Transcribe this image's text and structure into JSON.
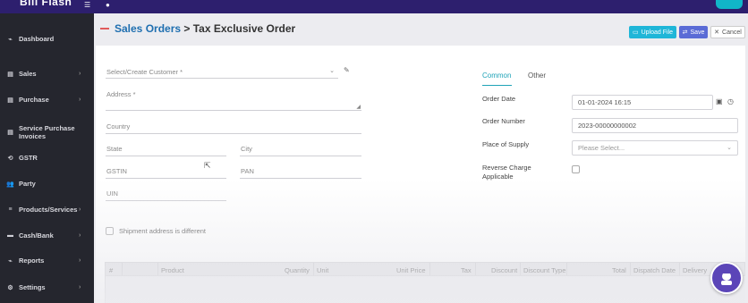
{
  "header": {
    "brand": "Bill Flash"
  },
  "sidebar": {
    "items": [
      {
        "label": "Dashboard",
        "icon": "chart-icon",
        "arrow": false
      },
      {
        "label": "Sales",
        "icon": "document-icon",
        "arrow": true
      },
      {
        "label": "Purchase",
        "icon": "document-icon",
        "arrow": true
      },
      {
        "label": "Service Purchase Invoices",
        "icon": "document-icon",
        "arrow": false
      },
      {
        "label": "GSTR",
        "icon": "refresh-icon",
        "arrow": false
      },
      {
        "label": "Party",
        "icon": "users-icon",
        "arrow": false
      },
      {
        "label": "Products/Services",
        "icon": "list-icon",
        "arrow": true
      },
      {
        "label": "Cash/Bank",
        "icon": "cash-icon",
        "arrow": true
      },
      {
        "label": "Reports",
        "icon": "chart-icon",
        "arrow": true
      },
      {
        "label": "Settings",
        "icon": "gear-icon",
        "arrow": true
      }
    ]
  },
  "page": {
    "breadcrumb_link": "Sales Orders",
    "breadcrumb_rest": " > Tax Exclusive Order"
  },
  "toolbar": {
    "upload_label": "Upload File",
    "save_label": "Save",
    "cancel_label": "Cancel"
  },
  "form": {
    "customer_placeholder": "Select/Create Customer *",
    "address_placeholder": "Address *",
    "country_placeholder": "Country",
    "state_placeholder": "State",
    "city_placeholder": "City",
    "gstin_placeholder": "GSTIN",
    "pan_placeholder": "PAN",
    "uin_placeholder": "UIN",
    "shipment_label": "Shipment address is different"
  },
  "details": {
    "tab_common": "Common",
    "tab_other": "Other",
    "order_date_label": "Order Date",
    "order_date_value": "01-01-2024 16:15",
    "order_number_label": "Order Number",
    "order_number_value": "2023-00000000002",
    "place_of_supply_label": "Place of Supply",
    "place_of_supply_placeholder": "Please Select...",
    "reverse_charge_label": "Reverse Charge Applicable"
  },
  "table": {
    "columns": [
      "#",
      "Product",
      "Quantity",
      "Unit",
      "Unit Price",
      "Tax",
      "Discount",
      "Discount Type",
      "Total",
      "Dispatch Date",
      "Delivery"
    ]
  },
  "colors": {
    "sidebar_bg": "#25262e",
    "header_bg": "#2d1f6e",
    "accent_teal": "#1fb6d8",
    "save_blue": "#5a6bd6",
    "breadcrumb_blue": "#1f6fb0"
  }
}
